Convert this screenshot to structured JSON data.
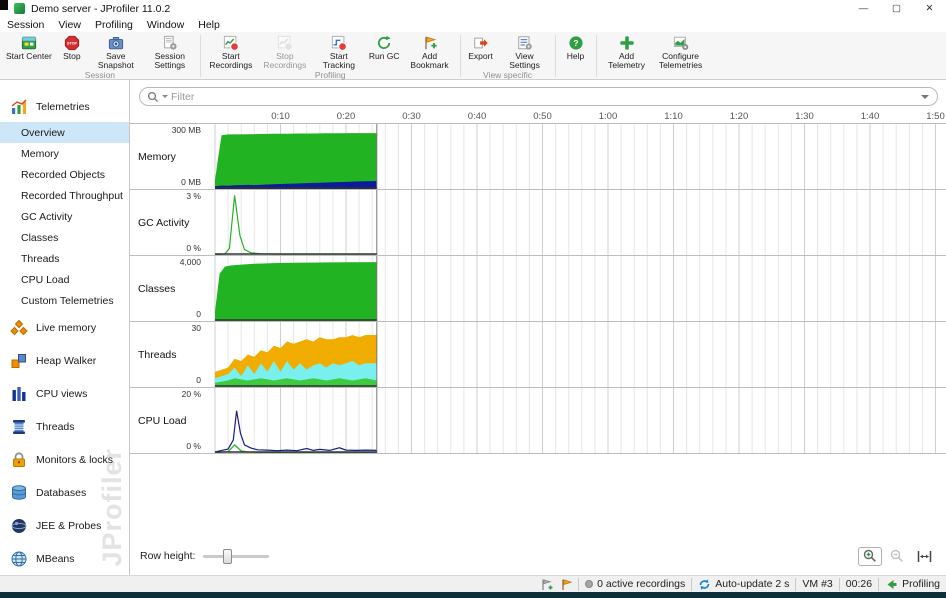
{
  "window": {
    "title": "Demo server - JProfiler 11.0.2",
    "controls": {
      "minimize": "—",
      "maximize": "▢",
      "close": "✕"
    }
  },
  "menubar": {
    "items": [
      "Session",
      "View",
      "Profiling",
      "Window",
      "Help"
    ]
  },
  "toolbar": {
    "buttons": [
      {
        "label": "Start Center",
        "icon": "start-center"
      },
      {
        "label": "Stop",
        "icon": "stop"
      },
      {
        "label": "Save Snapshot",
        "icon": "save-snapshot"
      },
      {
        "label": "Session Settings",
        "icon": "session-settings"
      },
      {
        "label": "Start Recordings",
        "icon": "start-recordings"
      },
      {
        "label": "Stop Recordings",
        "icon": "stop-recordings",
        "disabled": true
      },
      {
        "label": "Start Tracking",
        "icon": "start-tracking"
      },
      {
        "label": "Run GC",
        "icon": "run-gc"
      },
      {
        "label": "Add Bookmark",
        "icon": "add-bookmark"
      },
      {
        "label": "Export",
        "icon": "export"
      },
      {
        "label": "View Settings",
        "icon": "view-settings"
      },
      {
        "label": "Help",
        "icon": "help"
      },
      {
        "label": "Add Telemetry",
        "icon": "add-telemetry"
      },
      {
        "label": "Configure Telemetries",
        "icon": "configure-telemetries"
      }
    ],
    "group_labels": [
      "Session",
      "Profiling",
      "View specific"
    ]
  },
  "sidebar": {
    "sections": [
      {
        "label": "Telemetries",
        "icon": "telemetries"
      },
      {
        "label": "Live memory",
        "icon": "live-memory"
      },
      {
        "label": "Heap Walker",
        "icon": "heap-walker"
      },
      {
        "label": "CPU views",
        "icon": "cpu-views"
      },
      {
        "label": "Threads",
        "icon": "threads"
      },
      {
        "label": "Monitors & locks",
        "icon": "monitors-locks"
      },
      {
        "label": "Databases",
        "icon": "databases"
      },
      {
        "label": "JEE & Probes",
        "icon": "jee-probes"
      },
      {
        "label": "MBeans",
        "icon": "mbeans"
      }
    ],
    "telemetry_items": [
      "Overview",
      "Memory",
      "Recorded Objects",
      "Recorded Throughput",
      "GC Activity",
      "Classes",
      "Threads",
      "CPU Load",
      "Custom Telemetries"
    ],
    "selected_item": "Overview",
    "watermark": "JProfiler"
  },
  "main": {
    "filter_placeholder": "Filter",
    "timeline_ticks": [
      "0:10",
      "0:20",
      "0:30",
      "0:40",
      "0:50",
      "1:00",
      "1:10",
      "1:20",
      "1:30",
      "1:40",
      "1:50"
    ],
    "row_height_label": "Row height:"
  },
  "chart_meta": {
    "x_range_seconds": [
      0,
      113
    ],
    "data_end_seconds": 24.7,
    "minor_grid_seconds": 2,
    "major_grid_seconds": 10
  },
  "chart_data": [
    {
      "type": "area",
      "row_label": "Memory",
      "y_top": "300 MB",
      "y_bottom": "0 MB",
      "ymax": 300,
      "series": [
        {
          "name": "committed-memory",
          "color": "#22b322",
          "fill": "#22b322",
          "points": [
            [
              0,
              40
            ],
            [
              0.5,
              150
            ],
            [
              1,
              248
            ],
            [
              2,
              252
            ],
            [
              3,
              252
            ],
            [
              5,
              253
            ],
            [
              7,
              254
            ],
            [
              9,
              255
            ],
            [
              11,
              255
            ],
            [
              13,
              256
            ],
            [
              15,
              256
            ],
            [
              17,
              257
            ],
            [
              19,
              257
            ],
            [
              21,
              258
            ],
            [
              23,
              258
            ],
            [
              24.7,
              258
            ]
          ]
        },
        {
          "name": "used-memory",
          "color": "#0a1b9b",
          "fill": "#0a1b9b",
          "points": [
            [
              0,
              12
            ],
            [
              1,
              16
            ],
            [
              2,
              15
            ],
            [
              3,
              17
            ],
            [
              4,
              18
            ],
            [
              5,
              19
            ],
            [
              6,
              18
            ],
            [
              7,
              20
            ],
            [
              8,
              21
            ],
            [
              9,
              22
            ],
            [
              10,
              23
            ],
            [
              11,
              24
            ],
            [
              12,
              25
            ],
            [
              13,
              26
            ],
            [
              14,
              27
            ],
            [
              15,
              28
            ],
            [
              16,
              29
            ],
            [
              17,
              30
            ],
            [
              18,
              31
            ],
            [
              19,
              32
            ],
            [
              20,
              33
            ],
            [
              21,
              34
            ],
            [
              22,
              35
            ],
            [
              23,
              36
            ],
            [
              24.7,
              37
            ]
          ]
        }
      ]
    },
    {
      "type": "line",
      "row_label": "GC Activity",
      "y_top": "3 %",
      "y_bottom": "0 %",
      "ymax": 3,
      "series": [
        {
          "name": "gc-activity",
          "color": "#22b322",
          "points": [
            [
              0,
              0
            ],
            [
              1.5,
              0.05
            ],
            [
              2.2,
              0.3
            ],
            [
              3,
              2.75
            ],
            [
              3.8,
              0.9
            ],
            [
              4.5,
              0.25
            ],
            [
              5.5,
              0.1
            ],
            [
              7,
              0.05
            ],
            [
              10,
              0.04
            ],
            [
              14,
              0.04
            ],
            [
              18,
              0.04
            ],
            [
              22,
              0.04
            ],
            [
              24.7,
              0.04
            ]
          ]
        }
      ]
    },
    {
      "type": "area",
      "row_label": "Classes",
      "y_top": "4,000",
      "y_bottom": "0",
      "ymax": 4000,
      "series": [
        {
          "name": "loaded-classes",
          "color": "#22b322",
          "fill": "#22b322",
          "points": [
            [
              0,
              600
            ],
            [
              0.7,
              2900
            ],
            [
              1.5,
              3350
            ],
            [
              2.5,
              3420
            ],
            [
              4,
              3470
            ],
            [
              6,
              3520
            ],
            [
              9,
              3560
            ],
            [
              12,
              3580
            ],
            [
              16,
              3600
            ],
            [
              20,
              3615
            ],
            [
              24.7,
              3625
            ]
          ]
        }
      ]
    },
    {
      "type": "area",
      "row_label": "Threads",
      "y_top": "30",
      "y_bottom": "0",
      "ymax": 30,
      "series": [
        {
          "name": "total-threads",
          "color": "#f0ad00",
          "fill": "#f0ad00",
          "points": [
            [
              0,
              7
            ],
            [
              1,
              8
            ],
            [
              2,
              9
            ],
            [
              3,
              13
            ],
            [
              4,
              12
            ],
            [
              5,
              15
            ],
            [
              6,
              14
            ],
            [
              7,
              17
            ],
            [
              8,
              16
            ],
            [
              9,
              19
            ],
            [
              10,
              18
            ],
            [
              11,
              21
            ],
            [
              12,
              20
            ],
            [
              13,
              21
            ],
            [
              14,
              22
            ],
            [
              15,
              21
            ],
            [
              16,
              23
            ],
            [
              17,
              22
            ],
            [
              18,
              22
            ],
            [
              19,
              23
            ],
            [
              20,
              23
            ],
            [
              21,
              24
            ],
            [
              22,
              23
            ],
            [
              23,
              24
            ],
            [
              24.7,
              24
            ]
          ]
        },
        {
          "name": "waiting-threads",
          "color": "#7af0ee",
          "fill": "#7af0ee",
          "points": [
            [
              0,
              4
            ],
            [
              1,
              5
            ],
            [
              2,
              6
            ],
            [
              3,
              9
            ],
            [
              4,
              5
            ],
            [
              5,
              10
            ],
            [
              6,
              6
            ],
            [
              7,
              11
            ],
            [
              8,
              7
            ],
            [
              9,
              12
            ],
            [
              10,
              7
            ],
            [
              11,
              12
            ],
            [
              12,
              8
            ],
            [
              13,
              11
            ],
            [
              14,
              8
            ],
            [
              15,
              10
            ],
            [
              16,
              11
            ],
            [
              17,
              9
            ],
            [
              18,
              11
            ],
            [
              19,
              10
            ],
            [
              20,
              11
            ],
            [
              21,
              12
            ],
            [
              22,
              10
            ],
            [
              23,
              11
            ],
            [
              24.7,
              11
            ]
          ]
        },
        {
          "name": "runnable-threads",
          "color": "#3fca3f",
          "fill": "#3fca3f",
          "points": [
            [
              0,
              2
            ],
            [
              2,
              3
            ],
            [
              3,
              4
            ],
            [
              5,
              3
            ],
            [
              7,
              4
            ],
            [
              9,
              3
            ],
            [
              11,
              4
            ],
            [
              13,
              3
            ],
            [
              15,
              4
            ],
            [
              17,
              3
            ],
            [
              19,
              4
            ],
            [
              21,
              3
            ],
            [
              23,
              4
            ],
            [
              24.7,
              3
            ]
          ]
        }
      ]
    },
    {
      "type": "line",
      "row_label": "CPU Load",
      "y_top": "20 %",
      "y_bottom": "0 %",
      "ymax": 20,
      "series": [
        {
          "name": "cpu-load",
          "color": "#1a1a8c",
          "points": [
            [
              0,
              0.3
            ],
            [
              1,
              0.8
            ],
            [
              2,
              1.2
            ],
            [
              2.8,
              4
            ],
            [
              3.3,
              13
            ],
            [
              3.9,
              6
            ],
            [
              4.5,
              2.5
            ],
            [
              5.5,
              1.5
            ],
            [
              6.5,
              1
            ],
            [
              8,
              0.9
            ],
            [
              9.5,
              0.7
            ],
            [
              11,
              0.9
            ],
            [
              12.5,
              0.7
            ],
            [
              14,
              1.4
            ],
            [
              15,
              0.8
            ],
            [
              16,
              1.1
            ],
            [
              17.5,
              0.8
            ],
            [
              19,
              1.6
            ],
            [
              20,
              0.9
            ],
            [
              21.5,
              0.8
            ],
            [
              23,
              0.9
            ],
            [
              24.7,
              0.8
            ]
          ]
        },
        {
          "name": "gc-cpu-load",
          "color": "#22b322",
          "points": [
            [
              0,
              0.1
            ],
            [
              2,
              0.4
            ],
            [
              3,
              2.5
            ],
            [
              4,
              0.6
            ],
            [
              5,
              0.3
            ],
            [
              7,
              0.15
            ],
            [
              10,
              0.1
            ],
            [
              14,
              0.1
            ],
            [
              18,
              0.1
            ],
            [
              24.7,
              0.1
            ]
          ]
        }
      ]
    }
  ],
  "statusbar": {
    "recordings": "0 active recordings",
    "auto_update": "Auto-update 2 s",
    "vm": "VM #3",
    "time": "00:26",
    "state": "Profiling"
  },
  "colors": {
    "selection_blue": "#cde7f8",
    "accent_green": "#2f9e44",
    "chart_green": "#22b322",
    "chart_navy": "#0a1b9b",
    "chart_orange": "#f0ad00",
    "chart_cyan": "#7af0ee",
    "bottom_strip": "#0c2f3a"
  }
}
